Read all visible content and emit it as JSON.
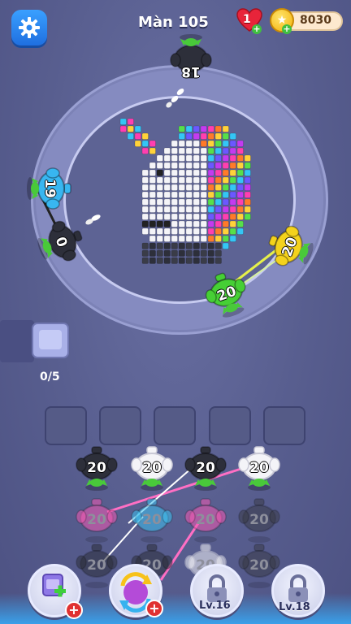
{
  "header": {
    "level_label": "Màn 105",
    "lives": "1",
    "coins": "8030",
    "settings_icon": "gear-icon",
    "heart_icon": "heart-icon",
    "coin_icon": "star-coin-icon"
  },
  "ring_units": [
    {
      "name": "ring-unit-black-top",
      "value": "18",
      "color": "#2d2f3a"
    },
    {
      "name": "ring-unit-blue-left",
      "value": "19",
      "color": "#38b6f0"
    },
    {
      "name": "ring-unit-black-left",
      "value": "0",
      "color": "#2d2f3a"
    },
    {
      "name": "ring-unit-yellow-right",
      "value": "20",
      "color": "#f4d21c"
    },
    {
      "name": "ring-unit-green-bottom",
      "value": "20",
      "color": "#46cf35"
    }
  ],
  "dispenser": {
    "count": "0/5"
  },
  "slots": [
    "",
    "",
    "",
    "",
    ""
  ],
  "grid_units": [
    {
      "name": "grid-unit-black-1",
      "value": "20",
      "color": "#2d2f3a",
      "dim": false
    },
    {
      "name": "grid-unit-white-1",
      "value": "20",
      "color": "#f4f4f8",
      "dim": false
    },
    {
      "name": "grid-unit-black-2",
      "value": "20",
      "color": "#2d2f3a",
      "dim": false
    },
    {
      "name": "grid-unit-white-2",
      "value": "20",
      "color": "#f4f4f8",
      "dim": false
    },
    {
      "name": "grid-unit-pink-1",
      "value": "20",
      "color": "#f25ab3",
      "dim": true
    },
    {
      "name": "grid-unit-cyan-1",
      "value": "20",
      "color": "#3ec0ef",
      "dim": true
    },
    {
      "name": "grid-unit-pink-2",
      "value": "20",
      "color": "#f25ab3",
      "dim": true
    },
    {
      "name": "grid-unit-dark-1",
      "value": "20",
      "color": "#3a3c48",
      "dim": true
    },
    {
      "name": "grid-unit-black-3",
      "value": "20",
      "color": "#2d2f3a",
      "dim": true
    },
    {
      "name": "grid-unit-black-4",
      "value": "20",
      "color": "#2d2f3a",
      "dim": true
    },
    {
      "name": "grid-unit-white-3",
      "value": "20",
      "color": "#f4f4f8",
      "dim": true
    },
    {
      "name": "grid-unit-dark-2",
      "value": "20",
      "color": "#3a3c48",
      "dim": true
    }
  ],
  "bottom": {
    "booster_add_slot_icon": "add-slot-icon",
    "booster_shuffle_icon": "shuffle-icon",
    "lock1_label": "Lv.16",
    "lock2_label": "Lv.18"
  }
}
